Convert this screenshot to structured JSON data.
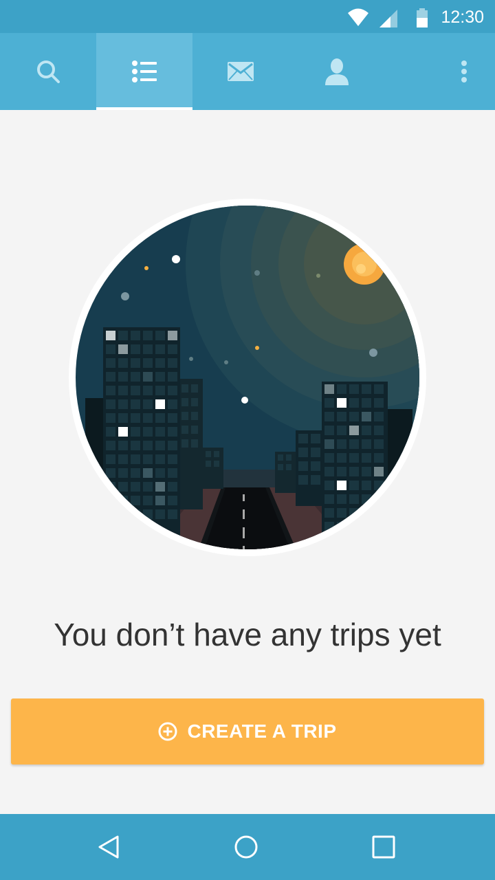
{
  "status_bar": {
    "time": "12:30",
    "icons": [
      "wifi-icon",
      "cell-signal-icon",
      "battery-icon"
    ]
  },
  "tabs": [
    {
      "name": "tab-search",
      "icon": "search-icon",
      "active": false
    },
    {
      "name": "tab-trips",
      "icon": "list-icon",
      "active": true
    },
    {
      "name": "tab-messages",
      "icon": "envelope-icon",
      "active": false
    },
    {
      "name": "tab-profile",
      "icon": "person-icon",
      "active": false
    }
  ],
  "overflow_icon": "more-vert-icon",
  "empty_state": {
    "illustration": "night-city-road-illustration",
    "message": "You don’t have any trips yet"
  },
  "create_button": {
    "icon": "add-circle-icon",
    "label": "CREATE A TRIP"
  },
  "nav_bar": {
    "icons": [
      "back-icon",
      "home-icon",
      "recents-icon"
    ]
  },
  "colors": {
    "status_bar": "#3da2c7",
    "app_bar": "#4db0d4",
    "active_tab": "#66bddd",
    "accent_button": "#fdb54a",
    "background": "#f4f4f4",
    "nav_bar": "#3ca2c7",
    "text": "#333333"
  }
}
